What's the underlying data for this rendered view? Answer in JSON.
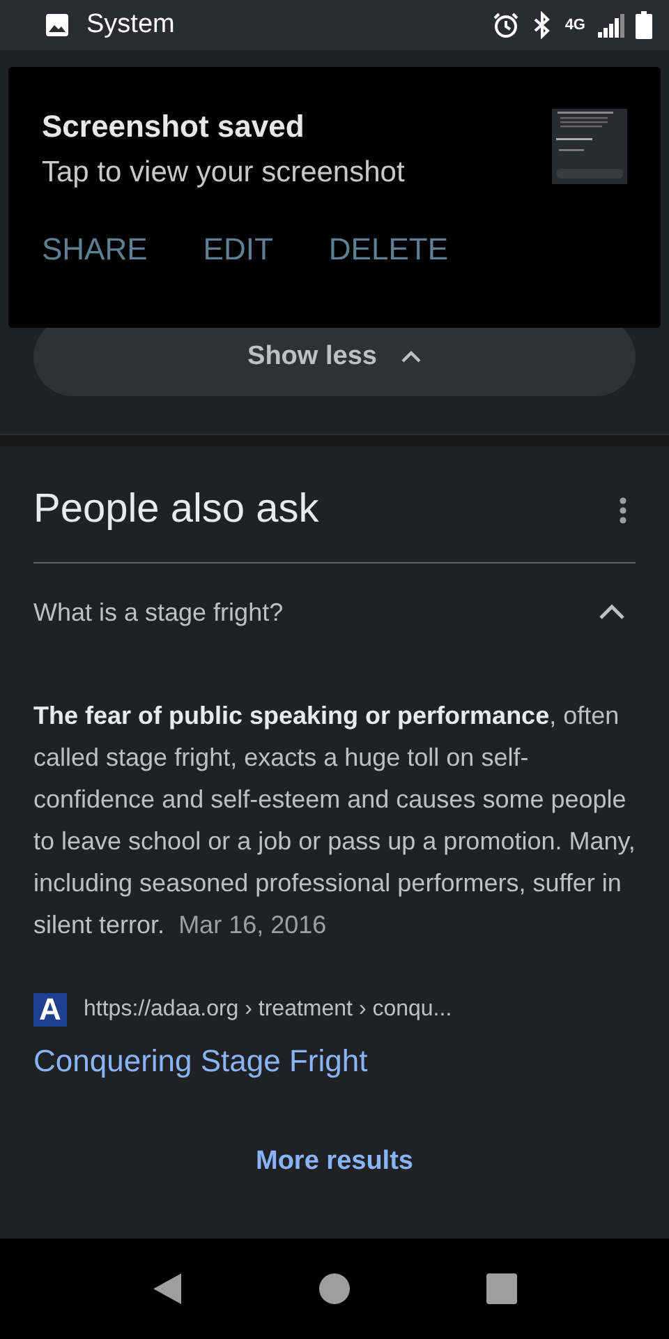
{
  "status_bar": {
    "app_name": "System",
    "network": "4G"
  },
  "notification": {
    "title": "Screenshot saved",
    "body": "Tap to view your screenshot",
    "actions": [
      "SHARE",
      "EDIT",
      "DELETE"
    ]
  },
  "show_less": {
    "label": "Show less",
    "expanded": true
  },
  "section": {
    "title": "People also ask",
    "questions": [
      {
        "question": "What is a stage fright?",
        "expanded": true,
        "answer": "**The fear of public speaking or performance**, often called stage fright, exacts a huge toll on self-confidence and self-esteem and causes some people to leave school or a job or pass up a promotion. Many, including seasoned professional performers, suffer in silent terror.",
        "date": "Mar 16, 2016",
        "favicon_letter": "A",
        "url": "https://adaa.org › treatment › conqu...",
        "link": "Conquering Stage Fright"
      }
    ]
  },
  "more_results": "More results"
}
